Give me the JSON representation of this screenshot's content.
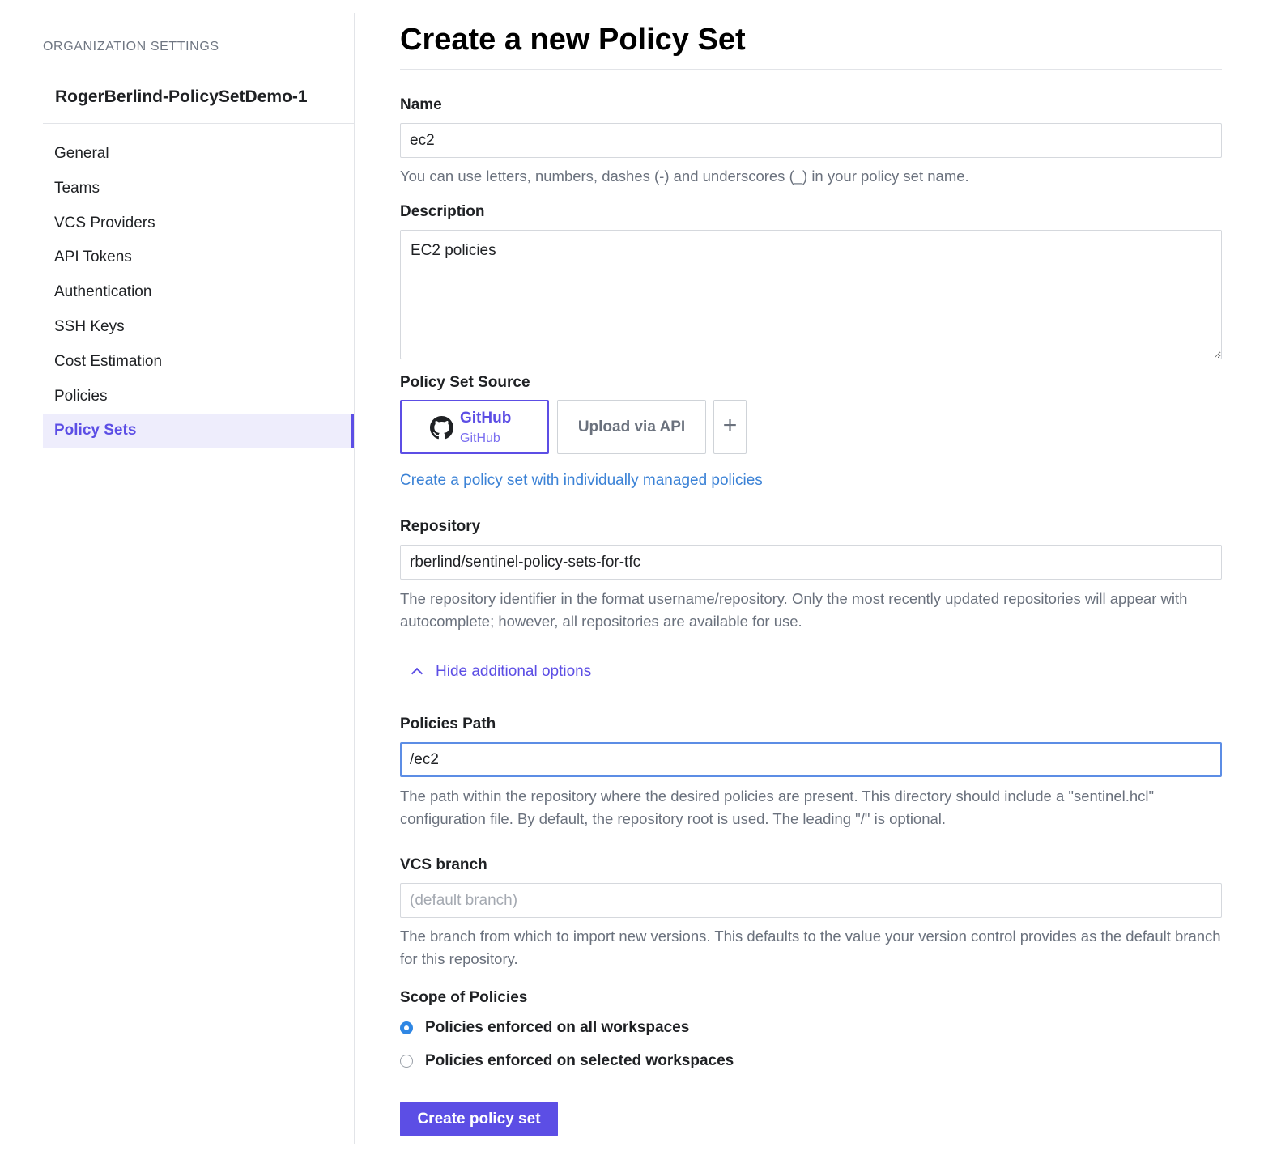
{
  "sidebar": {
    "heading": "Organization Settings",
    "org_name": "RogerBerlind-PolicySetDemo-1",
    "items": [
      {
        "label": "General"
      },
      {
        "label": "Teams"
      },
      {
        "label": "VCS Providers"
      },
      {
        "label": "API Tokens"
      },
      {
        "label": "Authentication"
      },
      {
        "label": "SSH Keys"
      },
      {
        "label": "Cost Estimation"
      },
      {
        "label": "Policies"
      },
      {
        "label": "Policy Sets"
      }
    ],
    "active_item": "Policy Sets"
  },
  "main": {
    "title": "Create a new Policy Set",
    "name": {
      "label": "Name",
      "value": "ec2",
      "help": "You can use letters, numbers, dashes (-) and underscores (_) in your policy set name."
    },
    "description": {
      "label": "Description",
      "value": "EC2 policies"
    },
    "source": {
      "label": "Policy Set Source",
      "github_title": "GitHub",
      "github_subtitle": "GitHub",
      "upload_label": "Upload via API",
      "add_label": "+",
      "individual_link": "Create a policy set with individually managed policies"
    },
    "repository": {
      "label": "Repository",
      "value": "rberlind/sentinel-policy-sets-for-tfc",
      "help": "The repository identifier in the format username/repository. Only the most recently updated repositories will appear with autocomplete; however, all repositories are available for use."
    },
    "additional_options_toggle": "Hide additional options",
    "policies_path": {
      "label": "Policies Path",
      "value": "/ec2",
      "help": "The path within the repository where the desired policies are present. This directory should include a \"sentinel.hcl\" configuration file. By default, the repository root is used. The leading \"/\" is optional."
    },
    "vcs_branch": {
      "label": "VCS branch",
      "value": "",
      "placeholder": "(default branch)",
      "help": "The branch from which to import new versions. This defaults to the value your version control provides as the default branch for this repository."
    },
    "scope": {
      "label": "Scope of Policies",
      "options": [
        {
          "label": "Policies enforced on all workspaces",
          "checked": true
        },
        {
          "label": "Policies enforced on selected workspaces",
          "checked": false
        }
      ]
    },
    "submit_label": "Create policy set"
  },
  "colors": {
    "accent": "#5c4ee5",
    "link": "#3b82d6",
    "radio_checked": "#2f87e4",
    "focus_border": "#5c8de5"
  },
  "icons": {
    "github": "github-icon",
    "chevron": "chevron-up-icon"
  }
}
